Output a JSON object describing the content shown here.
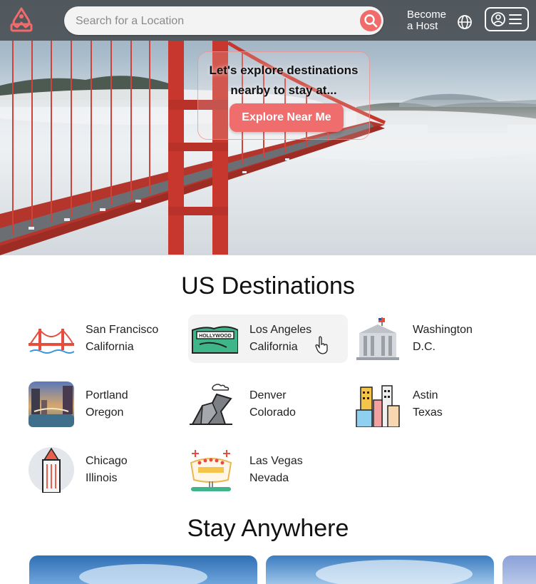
{
  "header": {
    "search_placeholder": "Search for a Location",
    "host_line1": "Become",
    "host_line2": "a Host",
    "icons": [
      "logo-icon",
      "search-icon",
      "globe-icon",
      "user-icon",
      "menu-icon"
    ]
  },
  "hero": {
    "line1": "Let's explore destinations",
    "line2": "nearby to stay at...",
    "button": "Explore Near Me"
  },
  "destinations_title": "US Destinations",
  "destinations": [
    {
      "city": "San Francisco",
      "region": "California",
      "icon": "golden-gate-icon"
    },
    {
      "city": "Los Angeles",
      "region": "California",
      "icon": "hollywood-sign-icon"
    },
    {
      "city": "Washington",
      "region": "D.C.",
      "icon": "white-house-icon"
    },
    {
      "city": "Portland",
      "region": "Oregon",
      "icon": "portland-photo-icon"
    },
    {
      "city": "Denver",
      "region": "Colorado",
      "icon": "denver-museum-icon"
    },
    {
      "city": "Astin",
      "region": "Texas",
      "icon": "city-skyline-icon"
    },
    {
      "city": "Chicago",
      "region": "Illinois",
      "icon": "chicago-tower-icon"
    },
    {
      "city": "Las Vegas",
      "region": "Nevada",
      "icon": "las-vegas-sign-icon"
    }
  ],
  "stay_title": "Stay Anywhere",
  "colors": {
    "accent": "#f26b6b",
    "header": "#464a4e",
    "bridge": "#c8372d"
  }
}
